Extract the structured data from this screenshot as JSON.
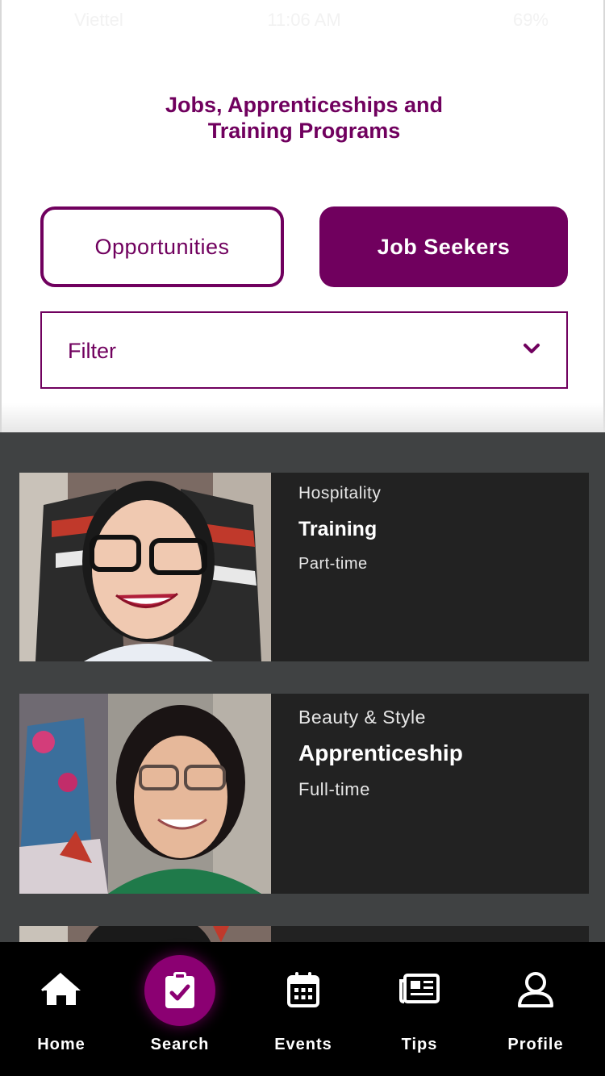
{
  "status_bar": {
    "carrier": "Viettel",
    "time": "11:06 AM",
    "battery": "69%"
  },
  "page": {
    "title_line1": "Jobs, Apprenticeships and",
    "title_line2": "Training Programs"
  },
  "toggle": {
    "opportunities_label": "Opportunities",
    "jobseekers_label": "Job Seekers",
    "selected": "Job Seekers"
  },
  "filter": {
    "label": "Filter"
  },
  "cards": [
    {
      "category": "Hospitality",
      "type": "Training",
      "hours": "Part-time"
    },
    {
      "category": "Beauty & Style",
      "type": "Apprenticeship",
      "hours": "Full-time"
    }
  ],
  "tabs": [
    {
      "label": "Home",
      "icon": "home-icon"
    },
    {
      "label": "Search",
      "icon": "clipboard-check-icon"
    },
    {
      "label": "Events",
      "icon": "calendar-icon"
    },
    {
      "label": "Tips",
      "icon": "newspaper-icon"
    },
    {
      "label": "Profile",
      "icon": "user-icon"
    }
  ],
  "colors": {
    "brand": "#70005e",
    "list_bg": "#404243",
    "card_bg": "#222222",
    "tab_bg": "#000000",
    "active_tab": "#8b0072"
  }
}
